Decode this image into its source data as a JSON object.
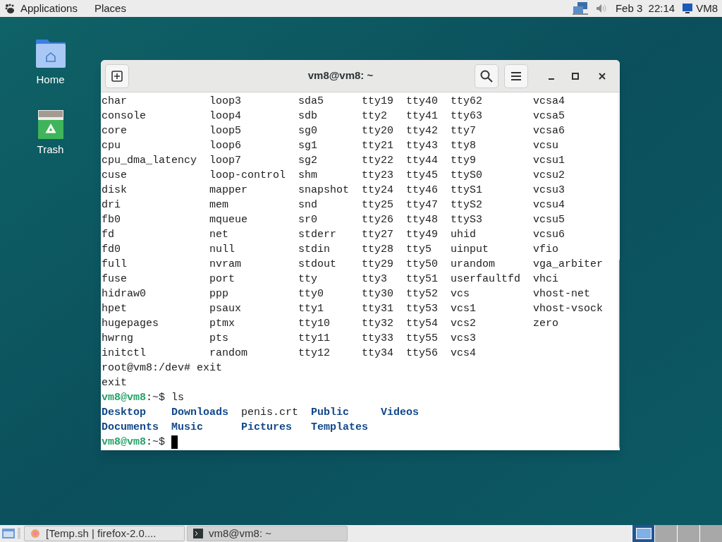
{
  "top_bar": {
    "menus": [
      "Applications",
      "Places"
    ],
    "clock": "Feb 3  22:14",
    "user": "VM8"
  },
  "desktop_icons": [
    {
      "kind": "home",
      "label": "Home"
    },
    {
      "kind": "trash",
      "label": "Trash"
    }
  ],
  "window": {
    "title": "vm8@vm8: ~",
    "listing": [
      {
        "cells": [
          "char",
          "loop3",
          "sda5",
          "tty19",
          "tty40",
          "tty62",
          "vcsa4"
        ]
      },
      {
        "cells": [
          "console",
          "loop4",
          "sdb",
          "tty2",
          "tty41",
          "tty63",
          "vcsa5"
        ]
      },
      {
        "cells": [
          "core",
          "loop5",
          "sg0",
          "tty20",
          "tty42",
          "tty7",
          "vcsa6"
        ]
      },
      {
        "cells": [
          "cpu",
          "loop6",
          "sg1",
          "tty21",
          "tty43",
          "tty8",
          "vcsu"
        ]
      },
      {
        "cells": [
          "cpu_dma_latency",
          "loop7",
          "sg2",
          "tty22",
          "tty44",
          "tty9",
          "vcsu1"
        ]
      },
      {
        "cells": [
          "cuse",
          "loop-control",
          "shm",
          "tty23",
          "tty45",
          "ttyS0",
          "vcsu2"
        ]
      },
      {
        "cells": [
          "disk",
          "mapper",
          "snapshot",
          "tty24",
          "tty46",
          "ttyS1",
          "vcsu3"
        ]
      },
      {
        "cells": [
          "dri",
          "mem",
          "snd",
          "tty25",
          "tty47",
          "ttyS2",
          "vcsu4"
        ]
      },
      {
        "cells": [
          "fb0",
          "mqueue",
          "sr0",
          "tty26",
          "tty48",
          "ttyS3",
          "vcsu5"
        ]
      },
      {
        "cells": [
          "fd",
          "net",
          "stderr",
          "tty27",
          "tty49",
          "uhid",
          "vcsu6"
        ]
      },
      {
        "cells": [
          "fd0",
          "null",
          "stdin",
          "tty28",
          "tty5",
          "uinput",
          "vfio"
        ]
      },
      {
        "cells": [
          "full",
          "nvram",
          "stdout",
          "tty29",
          "tty50",
          "urandom",
          "vga_arbiter"
        ]
      },
      {
        "cells": [
          "fuse",
          "port",
          "tty",
          "tty3",
          "tty51",
          "userfaultfd",
          "vhci"
        ]
      },
      {
        "cells": [
          "hidraw0",
          "ppp",
          "tty0",
          "tty30",
          "tty52",
          "vcs",
          "vhost-net"
        ]
      },
      {
        "cells": [
          "hpet",
          "psaux",
          "tty1",
          "tty31",
          "tty53",
          "vcs1",
          "vhost-vsock"
        ]
      },
      {
        "cells": [
          "hugepages",
          "ptmx",
          "tty10",
          "tty32",
          "tty54",
          "vcs2",
          "zero"
        ]
      },
      {
        "cells": [
          "hwrng",
          "pts",
          "tty11",
          "tty33",
          "tty55",
          "vcs3"
        ]
      },
      {
        "cells": [
          "initctl",
          "random",
          "tty12",
          "tty34",
          "tty56",
          "vcs4"
        ]
      }
    ],
    "lines": [
      {
        "kind": "output",
        "text": "root@vm8:/dev# exit"
      },
      {
        "kind": "output",
        "text": "exit"
      },
      {
        "kind": "prompt",
        "user": "vm8@vm8",
        "path": ":~$",
        "command": "ls"
      },
      {
        "kind": "files",
        "items": [
          {
            "name": "Desktop",
            "kind": "dir"
          },
          {
            "name": "Downloads",
            "kind": "dir"
          },
          {
            "name": "penis.crt",
            "kind": "file"
          },
          {
            "name": "Public",
            "kind": "dir"
          },
          {
            "name": "Videos",
            "kind": "dir"
          }
        ]
      },
      {
        "kind": "files",
        "items": [
          {
            "name": "Documents",
            "kind": "dir"
          },
          {
            "name": "Music",
            "kind": "dir"
          },
          {
            "name": "Pictures",
            "kind": "dir"
          },
          {
            "name": "Templates",
            "kind": "dir"
          }
        ]
      },
      {
        "kind": "prompt",
        "user": "vm8@vm8",
        "path": ":~$",
        "cursor": true
      }
    ]
  },
  "taskbar": {
    "tasks": [
      {
        "kind": "browser",
        "label": "[Temp.sh | firefox-2.0....",
        "selected": false
      },
      {
        "kind": "terminal",
        "label": "vm8@vm8: ~",
        "selected": true
      }
    ],
    "workspaces": [
      {
        "selected": true
      },
      {
        "selected": false
      },
      {
        "selected": false
      },
      {
        "selected": false
      }
    ]
  }
}
